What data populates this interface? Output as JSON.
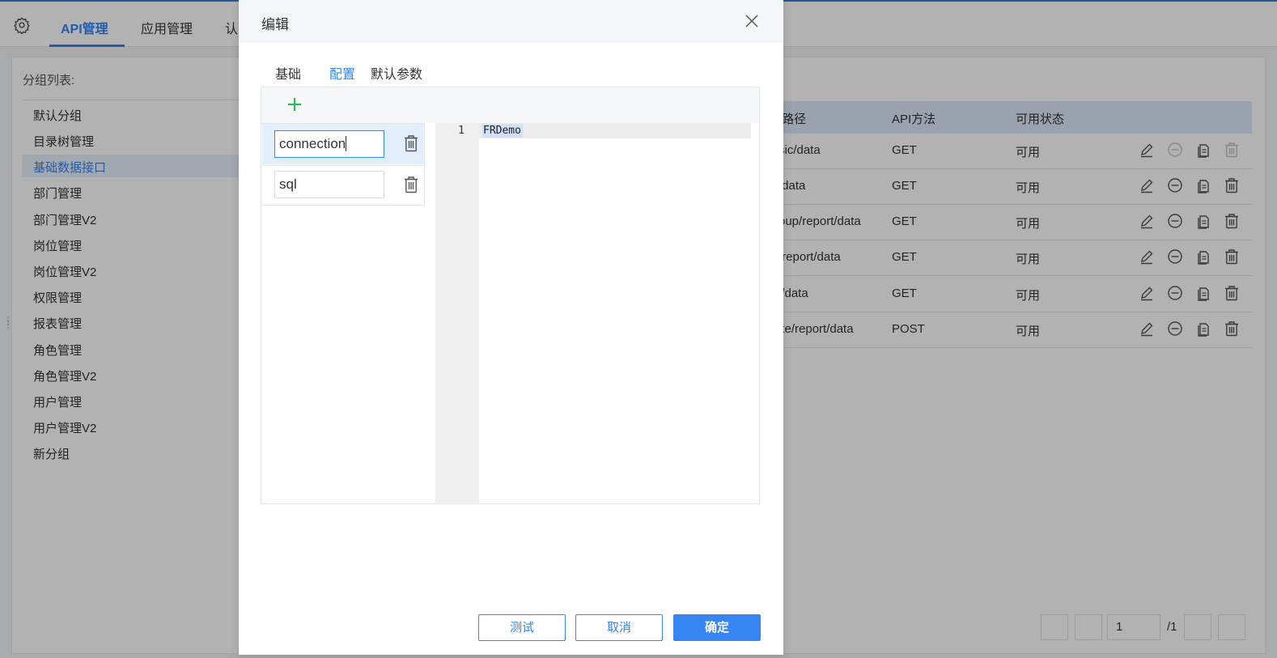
{
  "app": {
    "tabs": [
      "API管理",
      "应用管理",
      "认"
    ],
    "group_title": "分组列表:",
    "groups": [
      "默认分组",
      "目录树管理",
      "基础数据接口",
      "部门管理",
      "部门管理V2",
      "岗位管理",
      "岗位管理V2",
      "权限管理",
      "报表管理",
      "角色管理",
      "角色管理V2",
      "用户管理",
      "用户管理V2",
      "新分组"
    ],
    "selected_group": "基础数据接口",
    "table": {
      "headers": [
        "I路径",
        "API方法",
        "可用状态"
      ],
      "rows": [
        {
          "path": "sic/data",
          "method": "GET",
          "status": "可用"
        },
        {
          "path": "/data",
          "method": "GET",
          "status": "可用"
        },
        {
          "path": "oup/report/data",
          "method": "GET",
          "status": "可用"
        },
        {
          "path": "/report/data",
          "method": "GET",
          "status": "可用"
        },
        {
          "path": "l/data",
          "method": "GET",
          "status": "可用"
        },
        {
          "path": "ite/report/data",
          "method": "POST",
          "status": "可用"
        }
      ]
    },
    "pager": {
      "page": "1",
      "total": "/1"
    }
  },
  "dialog": {
    "title": "编辑",
    "tabs": [
      "基础",
      "配置",
      "默认参数"
    ],
    "active_tab": "配置",
    "keys": [
      "connection",
      "sql"
    ],
    "editor": {
      "line_number": "1",
      "code": "FRDemo"
    },
    "buttons": {
      "test": "测试",
      "cancel": "取消",
      "confirm": "确定"
    }
  },
  "colors": {
    "accent": "#3685f2",
    "add": "#2dbb5a"
  }
}
